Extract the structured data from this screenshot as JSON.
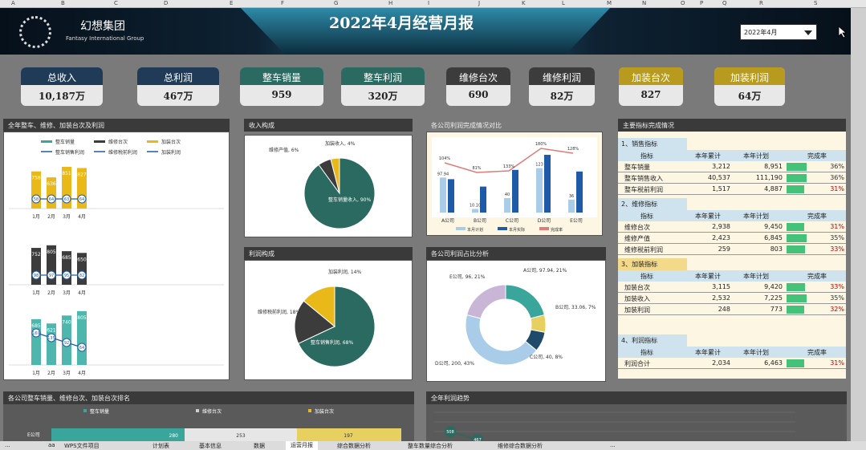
{
  "columns": [
    "A",
    "B",
    "C",
    "D",
    "E",
    "F",
    "G",
    "H",
    "I",
    "J",
    "K",
    "L",
    "M",
    "N",
    "O",
    "P",
    "Q",
    "R",
    "S"
  ],
  "header": {
    "brand": "幻想集团",
    "brand_en": "Fantasy International Group",
    "title": "2022年4月经营月报",
    "month": "2022年4月"
  },
  "kpis": [
    {
      "label": "总收入",
      "value": "10,187万",
      "color": "#1f3b57"
    },
    {
      "label": "总利润",
      "value": "467万",
      "color": "#1f3b57"
    },
    {
      "label": "整车销量",
      "value": "959",
      "color": "#2a6a60"
    },
    {
      "label": "整车利润",
      "value": "320万",
      "color": "#2a6a60"
    },
    {
      "label": "维修台次",
      "value": "690",
      "color": "#3c3c3c"
    },
    {
      "label": "维修利润",
      "value": "82万",
      "color": "#3c3c3c"
    },
    {
      "label": "加装台次",
      "value": "827",
      "color": "#b79a1e"
    },
    {
      "label": "加装利润",
      "value": "64万",
      "color": "#b79a1e"
    }
  ],
  "panels": {
    "p1": "全年整车、维修、加装台次及利润",
    "p2": "收入构成",
    "p3": "各公司利润完成情况对比",
    "p4": "主要指标完成情况",
    "p5": "利润构成",
    "p6": "各公司利润占比分析",
    "p7": "各公司整车销量、维修台次、加装台次排名",
    "p8": "全年利润趋势"
  },
  "legend1": [
    "整车销量",
    "维修台次",
    "加装台次",
    "整车销售利润",
    "维修税前利润",
    "加装利润"
  ],
  "legend3": [
    "本月计划",
    "本月实际",
    "完成率"
  ],
  "legend7": [
    "整车销量",
    "维修台次",
    "加装台次"
  ],
  "chart_data": [
    {
      "type": "bar",
      "title": "全年整车、维修、加装台次及利润",
      "categories": [
        "1月",
        "2月",
        "3月",
        "4月"
      ],
      "series": [
        {
          "name": "整车销量",
          "values": [
            758,
            636,
            851,
            827
          ]
        },
        {
          "name": "维修台次",
          "values": [
            752,
            805,
            685,
            650
          ]
        },
        {
          "name": "加装台次",
          "values": [
            685,
            621,
            740,
            805
          ]
        }
      ],
      "point_labels": [
        [
          "58",
          "64",
          "63",
          "64"
        ],
        [
          "98",
          "97",
          "95",
          "82"
        ],
        [
          "169",
          "135",
          "92",
          "64"
        ]
      ]
    },
    {
      "type": "pie",
      "title": "收入构成",
      "labels": [
        "整车销量收入, 90%",
        "维修产值, 6%",
        "加装收入, 4%"
      ],
      "values": [
        90,
        6,
        4
      ]
    },
    {
      "type": "bar",
      "title": "各公司利润完成情况对比",
      "categories": [
        "A公司",
        "B公司",
        "C公司",
        "D公司",
        "E公司"
      ],
      "series": [
        {
          "name": "本月计划",
          "values": [
            97,
            10,
            40,
            123,
            36
          ]
        },
        {
          "name": "本月实际",
          "values": [
            104,
            81,
            133,
            180,
            128
          ]
        }
      ],
      "point_labels": [
        "104%",
        "81%",
        "133%",
        "180%",
        "128%"
      ],
      "bar_labels": [
        "97.94",
        "10.10",
        "40",
        "123",
        "36"
      ]
    },
    {
      "type": "pie",
      "title": "利润构成",
      "labels": [
        "整车销售利润, 68%",
        "维修税前利润, 18%",
        "加装利润, 14%"
      ],
      "values": [
        68,
        18,
        14
      ]
    },
    {
      "type": "pie",
      "title": "各公司利润占比分析",
      "labels": [
        "A公司, 97.94, 21%",
        "B公司, 33.06, 7%",
        "C公司, 40, 8%",
        "D公司, 200, 43%",
        "E公司, 96, 21%"
      ],
      "values": [
        21,
        7,
        8,
        43,
        21
      ]
    },
    {
      "type": "bar",
      "title": "各公司整车销量、维修台次、加装台次排名",
      "categories": [
        "E公司"
      ],
      "series": [
        {
          "name": "整车销量",
          "values": [
            280
          ]
        },
        {
          "name": "维修台次",
          "values": [
            253
          ]
        },
        {
          "name": "加装台次",
          "values": [
            197
          ]
        }
      ],
      "point_labels": [
        "280",
        "253",
        "197"
      ]
    },
    {
      "type": "line",
      "title": "全年利润趋势",
      "labels": [
        "508",
        "467"
      ]
    }
  ],
  "indicator_table": {
    "sections": [
      {
        "name": "1、销售指标",
        "rows": [
          [
            "整车销量",
            "3,212",
            "8,951",
            "36%"
          ],
          [
            "整车销售收入",
            "40,537",
            "111,190",
            "36%"
          ],
          [
            "整车税前利润",
            "1,517",
            "4,887",
            "31%"
          ]
        ]
      },
      {
        "name": "2、维修指标",
        "rows": [
          [
            "维修台次",
            "2,938",
            "9,450",
            "31%"
          ],
          [
            "维修产值",
            "2,423",
            "6,845",
            "35%"
          ],
          [
            "维修税前利润",
            "259",
            "803",
            "33%"
          ]
        ]
      },
      {
        "name": "3、加装指标",
        "rows": [
          [
            "加装台次",
            "3,115",
            "9,420",
            "33%"
          ],
          [
            "加装收入",
            "2,532",
            "7,225",
            "35%"
          ],
          [
            "加装利润",
            "248",
            "773",
            "32%"
          ]
        ]
      },
      {
        "name": "4、利润指标",
        "rows": [
          [
            "利润合计",
            "2,034",
            "6,463",
            "31%"
          ]
        ]
      }
    ],
    "headers": [
      "指标",
      "本年累计",
      "本年计划",
      "完成率"
    ]
  },
  "tabs": [
    "...",
    "aa",
    "WPS文件项目",
    "计划表",
    "基本信息",
    "数据",
    "运营月报",
    "综合数据分析",
    "整车数量综合分析",
    "维修综合数据分析",
    "..."
  ]
}
